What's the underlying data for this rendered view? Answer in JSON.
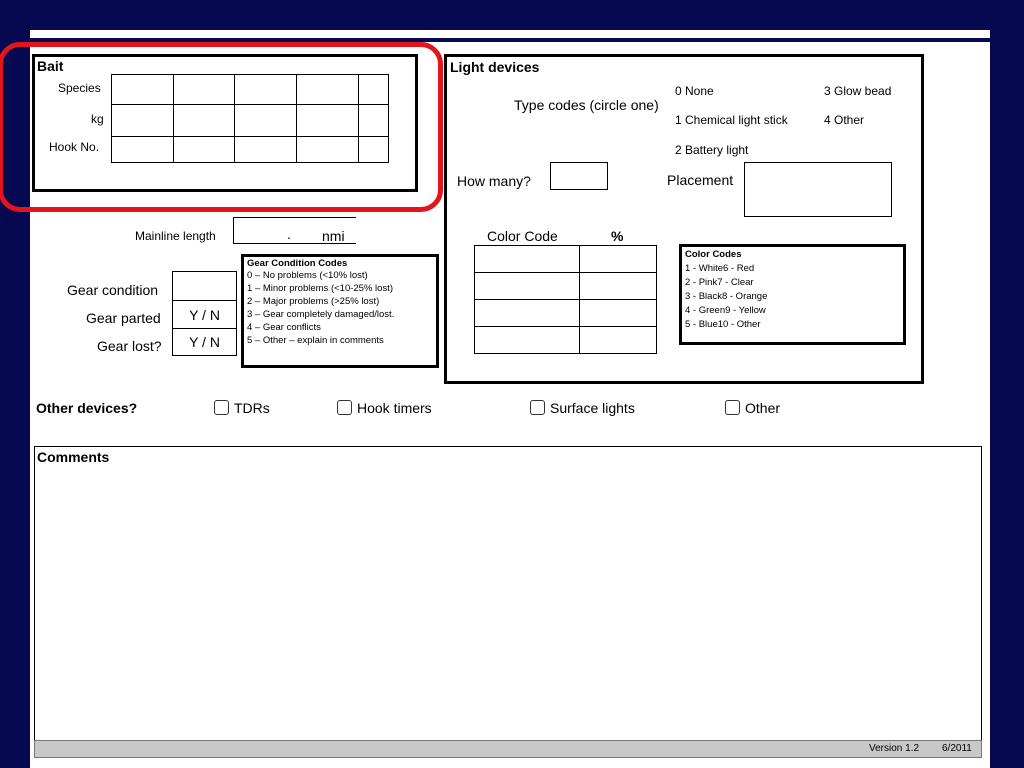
{
  "bait": {
    "title": "Bait",
    "rows": [
      "Species",
      "kg",
      "Hook No."
    ]
  },
  "light_devices": {
    "title": "Light devices",
    "type_codes_label": "Type codes (circle one)",
    "codes": [
      "0 None",
      "3 Glow bead",
      "1 Chemical light stick",
      "4 Other",
      "2 Battery light"
    ],
    "how_many_label": "How many?",
    "placement_label": "Placement",
    "color_code_header": "Color Code",
    "percent_header": "%",
    "color_codes_title": "Color Codes",
    "color_codes": [
      "1 - White6 - Red",
      "2 - Pink7 - Clear",
      "3 - Black8 - Orange",
      "4 - Green9 -   Yellow",
      "5 - Blue10 - Other"
    ]
  },
  "gear": {
    "mainline_label": "Mainline length",
    "mainline_dot": ".",
    "mainline_unit": "nmi",
    "condition_label": "Gear condition",
    "parted_label": "Gear parted",
    "lost_label": "Gear lost?",
    "yn": "Y / N",
    "codes_title": "Gear Condition Codes",
    "codes": [
      "0 – No problems  (<10% lost)",
      "1 – Minor problems  (<10-25% lost)",
      "2 – Major problems  (>25% lost)",
      "3 – Gear completely damaged/lost.",
      "4 – Gear conflicts",
      "5 – Other – explain in comments"
    ]
  },
  "other_devices": {
    "label": "Other devices?",
    "options": [
      "TDRs",
      "Hook timers",
      "Surface lights",
      "Other"
    ]
  },
  "comments": {
    "label": "Comments"
  },
  "footer": {
    "version": "Version 1.2",
    "date": "6/2011"
  }
}
